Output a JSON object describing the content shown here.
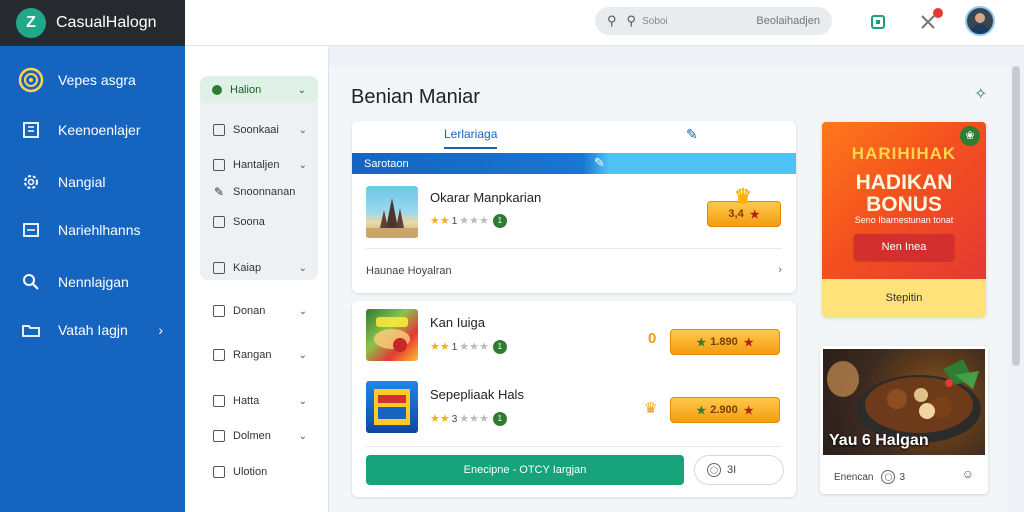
{
  "app": {
    "title": "CasualHalogn",
    "logo_letter": "Z"
  },
  "sidebar": {
    "items": [
      {
        "label": "Vepes asgra",
        "icon": "target-icon"
      },
      {
        "label": "Keenoenlajer",
        "icon": "building-icon"
      },
      {
        "label": "Nangial",
        "icon": "gear-icon"
      },
      {
        "label": "Nariehlhanns",
        "icon": "window-icon"
      },
      {
        "label": "Nennlajgan",
        "icon": "search-icon"
      },
      {
        "label": "Vatah Iagjn",
        "icon": "folder-icon",
        "chevron": "›"
      }
    ]
  },
  "topbar": {
    "search_placeholder": "Beolaihadjen",
    "search_hint": "Soboi",
    "notification_count": ""
  },
  "subpanel": {
    "active": {
      "label": "Halion"
    },
    "items": [
      {
        "label": "Soonkaai",
        "chevron": "⌄"
      },
      {
        "label": "Hantaljen",
        "chevron": "⌄"
      },
      {
        "label": "Snoonnanan",
        "chevron": ""
      },
      {
        "label": "Soona",
        "chevron": ""
      },
      {
        "label": "Kaiap",
        "chevron": "⌄"
      },
      {
        "label": "Donan",
        "chevron": "⌄"
      },
      {
        "label": "Rangan",
        "chevron": "⌄"
      },
      {
        "label": "Hatta",
        "chevron": "⌄"
      },
      {
        "label": "Dolmen",
        "chevron": "⌄"
      },
      {
        "label": "Ulotion",
        "chevron": ""
      }
    ]
  },
  "main": {
    "title": "Benian Maniar",
    "tab_active": "Lerlariaga",
    "section_bar": "Sarotaon",
    "items": [
      {
        "title": "Okarar Manpkarian",
        "rating_num": "1",
        "price": "3,4",
        "badge": "1"
      },
      {
        "title": "Kan Iuiga",
        "rating_num": "1",
        "price": "1.890",
        "badge": "1",
        "left_marker": "0"
      },
      {
        "title": "Sepepliaak Hals",
        "rating_num": "3",
        "price": "2.900",
        "badge": "1"
      }
    ],
    "footer_link": "Haunae Hoyalran",
    "footer_chevron": "›",
    "cta_label": "Enecipne - OTCY Iargjan",
    "cta_side_label": "3I"
  },
  "promo": {
    "headline": "HARIHIHAK",
    "big_line1": "HADIKAN",
    "big_line2": "BONUS",
    "subline": "Seno Ibarnestunan tonat",
    "button": "Nen Inea",
    "footer": "Stepitin"
  },
  "promo2": {
    "title": "Yau 6 Halgan",
    "footer_label": "Enencan",
    "footer_count": "3"
  },
  "colors": {
    "sidebar": "#1565c0",
    "accent_green": "#16a37a",
    "orange": "#f39c12"
  }
}
